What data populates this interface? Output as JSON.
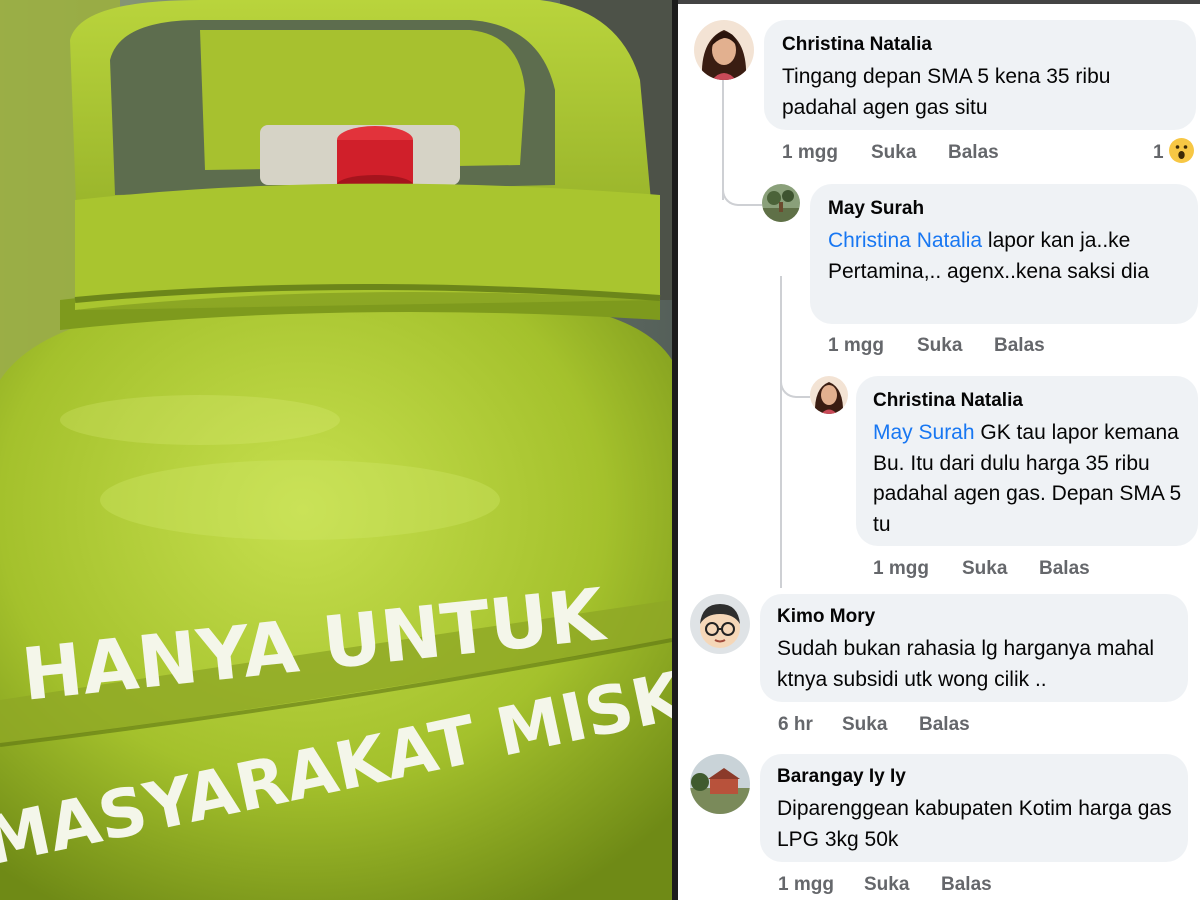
{
  "photo": {
    "line1": "HANYA UNTUK",
    "line2": "MASYARAKAT MISKIN",
    "colors": {
      "body": "#a8c531",
      "dark": "#6f8a16",
      "valve": "#d01f2a"
    }
  },
  "comments": [
    {
      "author": "Christina Natalia",
      "mention": "",
      "text": "Tingang depan SMA 5 kena 35 ribu padahal agen gas situ",
      "time": "1 mgg",
      "like": "Suka",
      "reply": "Balas",
      "reaction_count": "1",
      "reaction_icon": "wow-reaction-icon"
    },
    {
      "author": "May Surah",
      "mention": "Christina Natalia",
      "text": " lapor kan ja..ke Pertamina,.. agenx..kena saksi dia",
      "time": "1 mgg",
      "like": "Suka",
      "reply": "Balas"
    },
    {
      "author": "Christina Natalia",
      "mention": "May Surah",
      "text": " GK tau lapor kemana Bu. Itu dari dulu harga 35 ribu padahal agen gas. Depan SMA 5 tu",
      "time": "1 mgg",
      "like": "Suka",
      "reply": "Balas"
    },
    {
      "author": "Kimo Mory",
      "mention": "",
      "text": "Sudah bukan rahasia lg harganya mahal ktnya subsidi utk wong cilik ..",
      "time": "6 hr",
      "like": "Suka",
      "reply": "Balas"
    },
    {
      "author": "Barangay Iy Iy",
      "mention": "",
      "text": "Diparenggean kabupaten Kotim harga gas LPG 3kg 50k",
      "time": "1 mgg",
      "like": "Suka",
      "reply": "Balas"
    }
  ],
  "colors": {
    "bubble": "#eff2f5",
    "mention": "#1877f2",
    "meta": "#65676b"
  }
}
